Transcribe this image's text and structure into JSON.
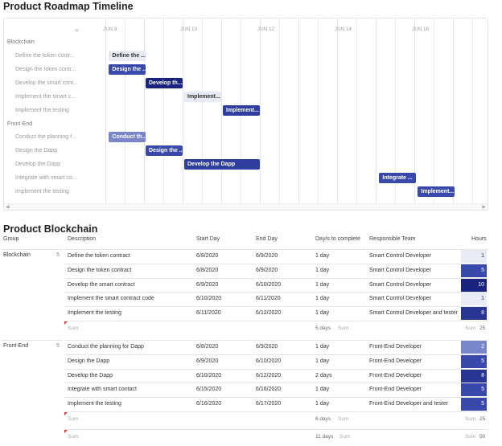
{
  "timeline": {
    "title": "Product Roadmap Timeline",
    "collapse_icon": "«",
    "dates": [
      "JUN 8",
      "JUN 10",
      "JUN 12",
      "JUN 14",
      "JUN 16"
    ],
    "groups": [
      {
        "label": "Blockchain",
        "items": [
          {
            "label": "Define the token contr...",
            "bar": "Define the ...",
            "color": "#e8eaf6",
            "text": "#333"
          },
          {
            "label": "Design the token contr...",
            "bar": "Design the ...",
            "color": "#3949ab",
            "text": "#fff"
          },
          {
            "label": "Develop the smart cont...",
            "bar": "Develop th...",
            "color": "#1a237e",
            "text": "#fff"
          },
          {
            "label": "Implement the smart c...",
            "bar": "Implement...",
            "color": "#e8eaf6",
            "text": "#333"
          },
          {
            "label": "Implement the testing",
            "bar": "Implement...",
            "color": "#303f9f",
            "text": "#fff"
          }
        ]
      },
      {
        "label": "Front-End",
        "items": [
          {
            "label": "Conduct the planning f...",
            "bar": "Conduct th...",
            "color": "#7986cb",
            "text": "#fff"
          },
          {
            "label": "Design the Dapp",
            "bar": "Design the ...",
            "color": "#3949ab",
            "text": "#fff"
          },
          {
            "label": "Develop the Dapp",
            "bar": "Develop the Dapp",
            "color": "#303f9f",
            "text": "#fff"
          },
          {
            "label": "Integrate with smart co...",
            "bar": "Integrate ...",
            "color": "#3949ab",
            "text": "#fff"
          },
          {
            "label": "Implement the testing",
            "bar": "Implement...",
            "color": "#3949ab",
            "text": "#fff"
          }
        ]
      }
    ]
  },
  "table": {
    "title": "Product Blockchain",
    "headers": {
      "group": "Group",
      "description": "Description",
      "start": "Start Day",
      "end": "End Day",
      "days": "Day/s to complete",
      "team": "Responsible Team",
      "hours": "Hours"
    },
    "sum_label": "Sum",
    "groups": [
      {
        "name": "Blockchain",
        "count": "5",
        "rows": [
          {
            "desc": "Define the token contract",
            "start": "6/8/2020",
            "end": "6/9/2020",
            "days": "1 day",
            "team": "Smart Control Developer",
            "hours": "1",
            "hcolor": "#e8eaf6",
            "htext": "#333"
          },
          {
            "desc": "Design the token contract",
            "start": "6/8/2020",
            "end": "6/9/2020",
            "days": "1 day",
            "team": "Smart Control Developer",
            "hours": "5",
            "hcolor": "#3949ab",
            "htext": "#fff"
          },
          {
            "desc": "Develop the smart contract",
            "start": "6/9/2020",
            "end": "6/10/2020",
            "days": "1 day",
            "team": "Smart Control Developer",
            "hours": "10",
            "hcolor": "#1a237e",
            "htext": "#fff"
          },
          {
            "desc": "Implement the smart contract code",
            "start": "6/10/2020",
            "end": "6/11/2020",
            "days": "1 day",
            "team": "Smart Control Developer",
            "hours": "1",
            "hcolor": "#e8eaf6",
            "htext": "#333"
          },
          {
            "desc": "Implement the testing",
            "start": "6/11/2020",
            "end": "6/12/2020",
            "days": "1 day",
            "team": "Smart Control Developer and tester",
            "hours": "8",
            "hcolor": "#283593",
            "htext": "#fff"
          }
        ],
        "sum_days": "5 days",
        "sum_hours": "25"
      },
      {
        "name": "Front-End",
        "count": "5",
        "rows": [
          {
            "desc": "Conduct the planning for Dapp",
            "start": "6/8/2020",
            "end": "6/9/2020",
            "days": "1 day",
            "team": "Front-End Developer",
            "hours": "2",
            "hcolor": "#7986cb",
            "htext": "#fff"
          },
          {
            "desc": "Design the Dapp",
            "start": "6/9/2020",
            "end": "6/10/2020",
            "days": "1 day",
            "team": "Front-End Developer",
            "hours": "5",
            "hcolor": "#3949ab",
            "htext": "#fff"
          },
          {
            "desc": "Develop the Dapp",
            "start": "6/10/2020",
            "end": "6/12/2020",
            "days": "2 days",
            "team": "Front-End Developer",
            "hours": "8",
            "hcolor": "#283593",
            "htext": "#fff"
          },
          {
            "desc": "Integrate with smart contact",
            "start": "6/15/2020",
            "end": "6/16/2020",
            "days": "1 day",
            "team": "Front-End Developer",
            "hours": "5",
            "hcolor": "#3949ab",
            "htext": "#fff"
          },
          {
            "desc": "Implement the testing",
            "start": "6/16/2020",
            "end": "6/17/2020",
            "days": "1 day",
            "team": "Front-End Developer and tester",
            "hours": "5",
            "hcolor": "#3949ab",
            "htext": "#fff"
          }
        ],
        "sum_days": "6 days",
        "sum_hours": "25"
      }
    ],
    "total_days": "11 days",
    "total_hours": "50"
  }
}
